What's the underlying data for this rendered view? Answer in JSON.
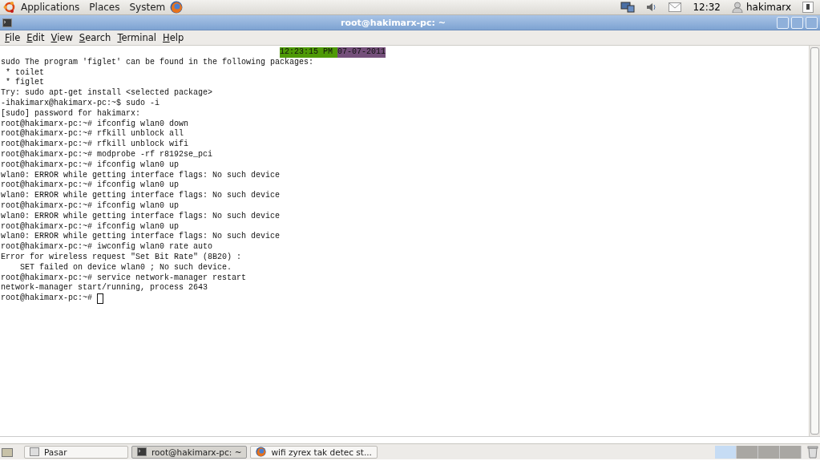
{
  "top_panel": {
    "menus": [
      "Applications",
      "Places",
      "System"
    ],
    "clock": "12:32",
    "user": "hakimarx"
  },
  "window": {
    "title": "root@hakimarx-pc: ~",
    "menu": [
      "File",
      "Edit",
      "View",
      "Search",
      "Terminal",
      "Help"
    ]
  },
  "terminal": {
    "clock_time": "12:23:15 PM",
    "clock_date": "07-07-2011",
    "lines": [
      "sudo The program 'figlet' can be found in the following packages:",
      " * toilet",
      " * figlet",
      "Try: sudo apt-get install <selected package>",
      "-ihakimarx@hakimarx-pc:~$ sudo -i",
      "[sudo] password for hakimarx:",
      "root@hakimarx-pc:~# ifconfig wlan0 down",
      "root@hakimarx-pc:~# rfkill unblock all",
      "root@hakimarx-pc:~# rfkill unblock wifi",
      "root@hakimarx-pc:~# modprobe -rf r8192se_pci",
      "root@hakimarx-pc:~# ifconfig wlan0 up",
      "wlan0: ERROR while getting interface flags: No such device",
      "root@hakimarx-pc:~# ifconfig wlan0 up",
      "wlan0: ERROR while getting interface flags: No such device",
      "root@hakimarx-pc:~# ifconfig wlan0 up",
      "wlan0: ERROR while getting interface flags: No such device",
      "root@hakimarx-pc:~# ifconfig wlan0 up",
      "wlan0: ERROR while getting interface flags: No such device",
      "root@hakimarx-pc:~# iwconfig wlan0 rate auto",
      "Error for wireless request \"Set Bit Rate\" (8B20) :",
      "    SET failed on device wlan0 ; No such device.",
      "root@hakimarx-pc:~# service network-manager restart",
      "network-manager start/running, process 2643"
    ],
    "prompt": "root@hakimarx-pc:~#"
  },
  "taskbar": {
    "items": [
      {
        "label": "Pasar",
        "kind": "folder",
        "selected": false
      },
      {
        "label": "root@hakimarx-pc: ~",
        "kind": "terminal",
        "selected": true
      },
      {
        "label": "wifi zyrex tak detec st...",
        "kind": "browser",
        "selected": false
      }
    ],
    "workspaces": [
      {
        "selected": true
      },
      {
        "selected": false
      },
      {
        "selected": false
      },
      {
        "selected": false
      }
    ]
  }
}
